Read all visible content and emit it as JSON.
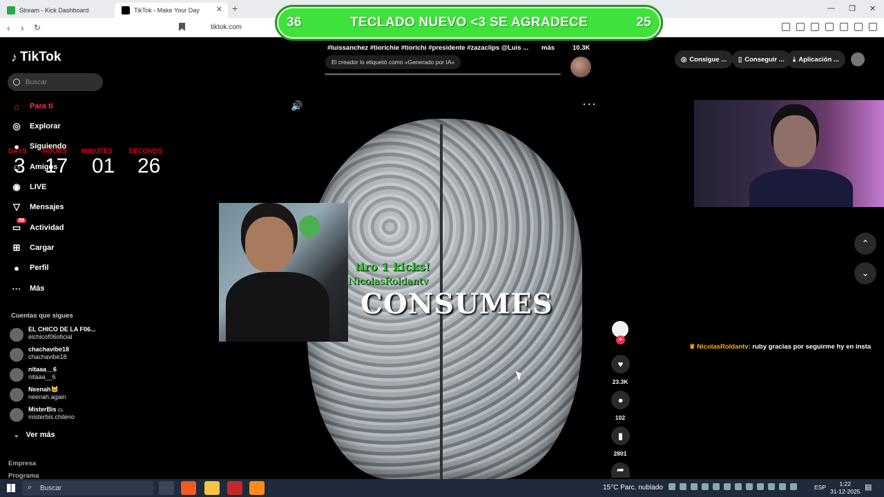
{
  "browser": {
    "tabs": [
      {
        "label": "Stream - Kick Dashboard"
      },
      {
        "label": "TikTok - Make Your Day"
      }
    ],
    "url": "tiktok.com"
  },
  "banner": {
    "left_number": "36",
    "text": "TECLADO NUEVO <3 SE AGRADECE",
    "right_number": "25",
    "color": "#3fe23a"
  },
  "sidebar": {
    "logo": "TikTok",
    "search_placeholder": "Buscar",
    "nav": [
      {
        "label": "Para ti",
        "icon": "home-icon",
        "active": true
      },
      {
        "label": "Explorar",
        "icon": "compass-icon"
      },
      {
        "label": "Siguiendo",
        "icon": "following-icon"
      },
      {
        "label": "Amigos",
        "icon": "friends-icon"
      },
      {
        "label": "LIVE",
        "icon": "live-icon"
      },
      {
        "label": "Mensajes",
        "icon": "messages-icon"
      },
      {
        "label": "Actividad",
        "icon": "activity-icon",
        "badge": "59"
      },
      {
        "label": "Cargar",
        "icon": "upload-icon"
      },
      {
        "label": "Perfil",
        "icon": "profile-icon"
      },
      {
        "label": "Más",
        "icon": "more-icon"
      }
    ],
    "following_title": "Cuentas que sigues",
    "following": [
      {
        "name": "EL CHICO DE LA F06...",
        "handle": "elchicof06oficial"
      },
      {
        "name": "chachavibe18",
        "handle": "chachavibe18"
      },
      {
        "name": "nitaaa__6",
        "handle": "nitaaa__6"
      },
      {
        "name": "Neenah🐱",
        "handle": "neenah.again"
      },
      {
        "name": "MisterBis",
        "flag": "CL",
        "handle": "misterbis.chileno"
      }
    ],
    "see_more": "Ver más",
    "footer": [
      "Empresa",
      "Programa"
    ]
  },
  "timer": {
    "labels": {
      "days": "DAYS",
      "hours": "HOURS",
      "minutes": "MINUTES",
      "seconds": "SECONDS"
    },
    "days": "3",
    "hours": "17",
    "minutes": "01",
    "seconds": "26"
  },
  "video": {
    "caption": "#luissanchez #tiorichie #tiorichi #presidente #zazaclips @Luis ...",
    "caption_more": "más",
    "ai_label": "El creador lo etiquetó como «Generado por IA»",
    "views": "10.3K",
    "overlay_text": "CONSUMES",
    "kick_alert_line1": "tiro 1 kicks!",
    "kick_alert_line2": "NicolasRoldantv"
  },
  "actions": {
    "likes": "23.3K",
    "comments": "102",
    "saves": "2801"
  },
  "top_right": {
    "buttons": [
      "Consigue ...",
      "Conseguir ...",
      "Aplicación ..."
    ]
  },
  "chat": {
    "user": "NicolasRoldantv:",
    "message": " ruby gracias por seguirme hy en insta"
  },
  "taskbar": {
    "search": "Buscar",
    "weather": "15°C  Parc. nublado",
    "lang": "ESP",
    "time": "1:22",
    "date": "31-12-2025"
  }
}
